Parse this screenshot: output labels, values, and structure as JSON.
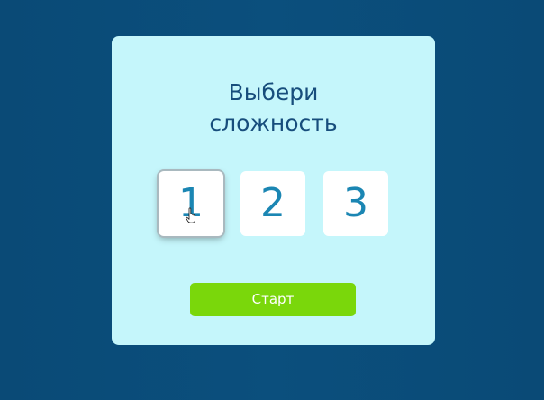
{
  "title": {
    "line1": "Выбери",
    "line2": "сложность"
  },
  "levels": [
    {
      "label": "1",
      "selected": true
    },
    {
      "label": "2",
      "selected": false
    },
    {
      "label": "3",
      "selected": false
    }
  ],
  "start_button": {
    "label": "Старт"
  },
  "colors": {
    "background": "#0a4a76",
    "card": "#c5f6fb",
    "title_text": "#174d7c",
    "level_text": "#1b86b3",
    "start_button": "#7ad70b"
  },
  "cursor_icon": "pointer-hand-icon"
}
